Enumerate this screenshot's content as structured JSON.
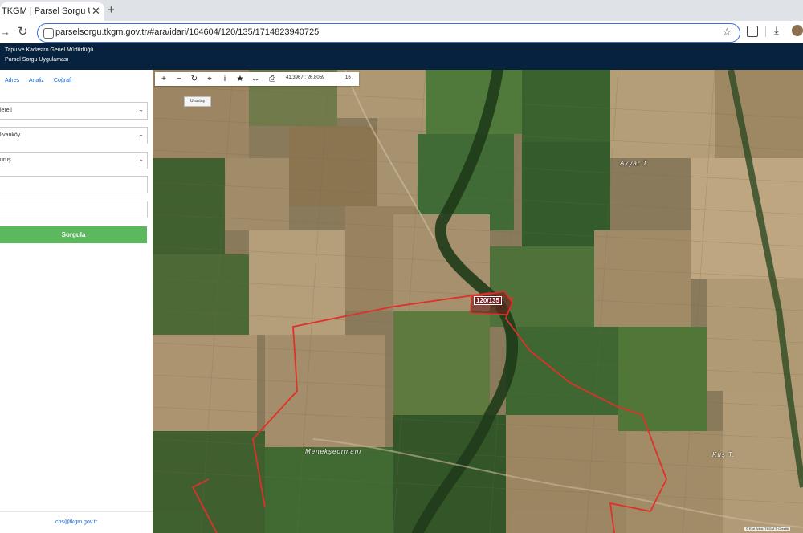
{
  "browser": {
    "tab_title": "TKGM | Parsel Sorgu Uygulam",
    "tab_close": "✕",
    "new_tab": "+",
    "url": "parselsorgu.tkgm.gov.tr/#ara/idari/164604/120/135/1714823940725"
  },
  "header": {
    "org": "Tapu ve Kadastro Genel Müdürlüğü",
    "app": "Parsel Sorgu Uygulaması"
  },
  "sidebar": {
    "menu": [
      "Adres",
      "Analiz",
      "Coğrafi"
    ],
    "fields": [
      {
        "value": "lereli",
        "type": "select"
      },
      {
        "value": "livanköy",
        "type": "select"
      },
      {
        "value": "uruş",
        "type": "select"
      },
      {
        "value": "",
        "type": "input"
      },
      {
        "value": "",
        "type": "input"
      }
    ],
    "query_button": "Sorgula",
    "footer_email": "cbs@tkgm.gov.tr"
  },
  "map": {
    "coords": "41.3967 : 26.8059",
    "zoom": "16",
    "basemap_button": "Uzaktaş",
    "parcel_label": "120/135",
    "places": [
      "Akyar T.",
      "Menekşeormanı",
      "Kuş T."
    ],
    "attribution": "© Esri Arbor, TKGM © Creatik",
    "tools": [
      "zoom-in",
      "zoom-out",
      "refresh",
      "locate",
      "info",
      "bookmark",
      "measure",
      "print"
    ],
    "colors": {
      "boundary": "#e0302a",
      "field_brown": "#a58b68",
      "field_green": "#3f6b32"
    }
  }
}
